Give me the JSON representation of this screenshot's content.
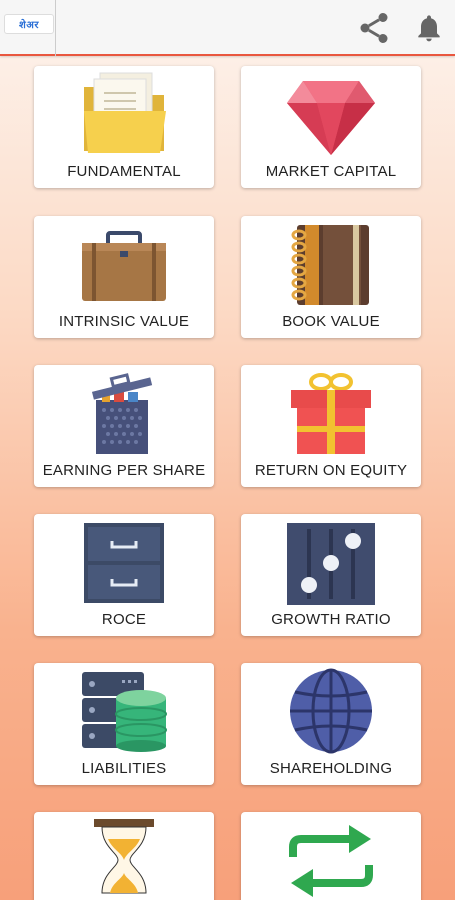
{
  "app_bar": {
    "logo_text_a": "शेअर",
    "logo_text_b": "",
    "share_icon": "share-icon",
    "bell_icon": "bell-icon"
  },
  "tiles": [
    {
      "label": "FUNDAMENTAL",
      "icon": "folder-icon"
    },
    {
      "label": "MARKET CAPITAL",
      "icon": "ruby-icon"
    },
    {
      "label": "INTRINSIC VALUE",
      "icon": "briefcase-icon"
    },
    {
      "label": "BOOK VALUE",
      "icon": "notebook-icon"
    },
    {
      "label": "EARNING PER SHARE",
      "icon": "trash-bin-icon"
    },
    {
      "label": "RETURN ON EQUITY",
      "icon": "gift-icon"
    },
    {
      "label": "ROCE",
      "icon": "cabinet-icon"
    },
    {
      "label": "GROWTH RATIO",
      "icon": "sliders-icon"
    },
    {
      "label": "LIABILITIES",
      "icon": "database-icon"
    },
    {
      "label": "SHAREHOLDING",
      "icon": "globe-icon"
    },
    {
      "label": "",
      "icon": "hourglass-icon"
    },
    {
      "label": "",
      "icon": "repeat-arrows-icon"
    }
  ],
  "colors": {
    "accent": "#e9573f",
    "background_top": "#fdf4ee",
    "background_bottom": "#f7a07a"
  }
}
